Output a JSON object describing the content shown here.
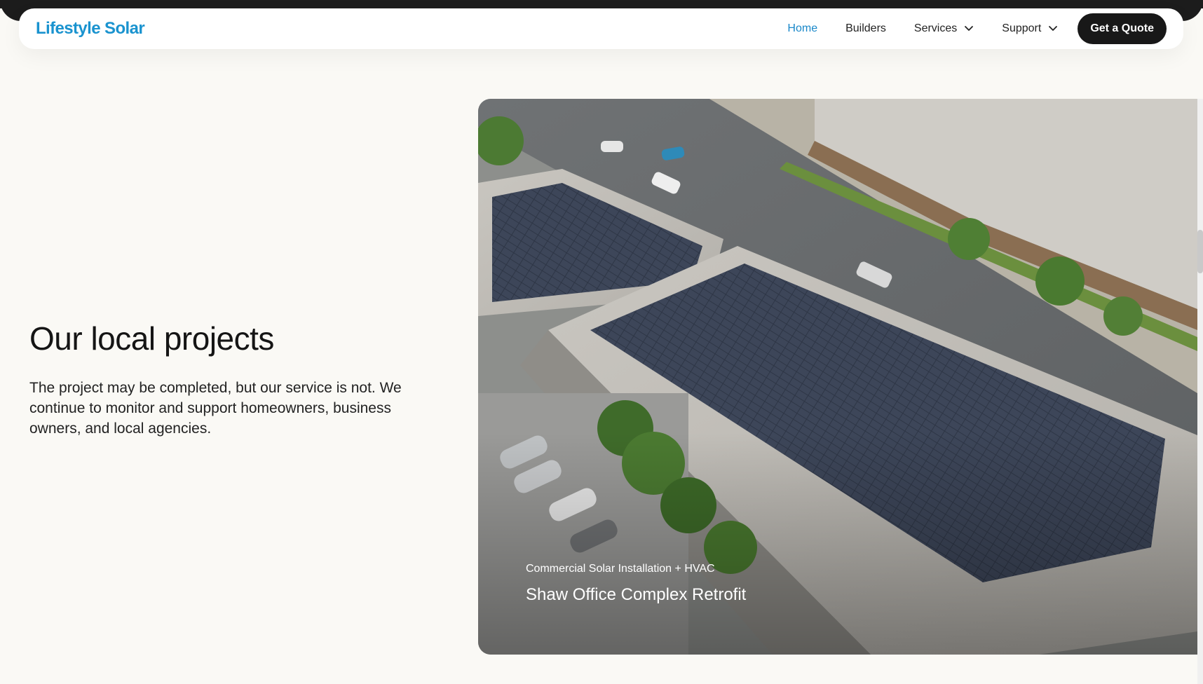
{
  "brand": {
    "logo_text": "Lifestyle Solar",
    "color": "#1a93cf"
  },
  "nav": {
    "links": [
      {
        "label": "Home",
        "active": true
      },
      {
        "label": "Builders"
      },
      {
        "label": "Services",
        "dropdown": true
      },
      {
        "label": "Support",
        "dropdown": true
      }
    ],
    "cta_label": "Get a Quote"
  },
  "section": {
    "title": "Our local projects",
    "description": "The project may be completed, but our service is not. We continue to monitor and support homeowners, business owners, and local agencies."
  },
  "project": {
    "category": "Commercial Solar Installation + HVAC",
    "name": "Shaw Office Complex Retrofit"
  },
  "colors": {
    "accent": "#1a88c9",
    "cta_bg": "#181818",
    "page_bg": "#faf9f5"
  }
}
